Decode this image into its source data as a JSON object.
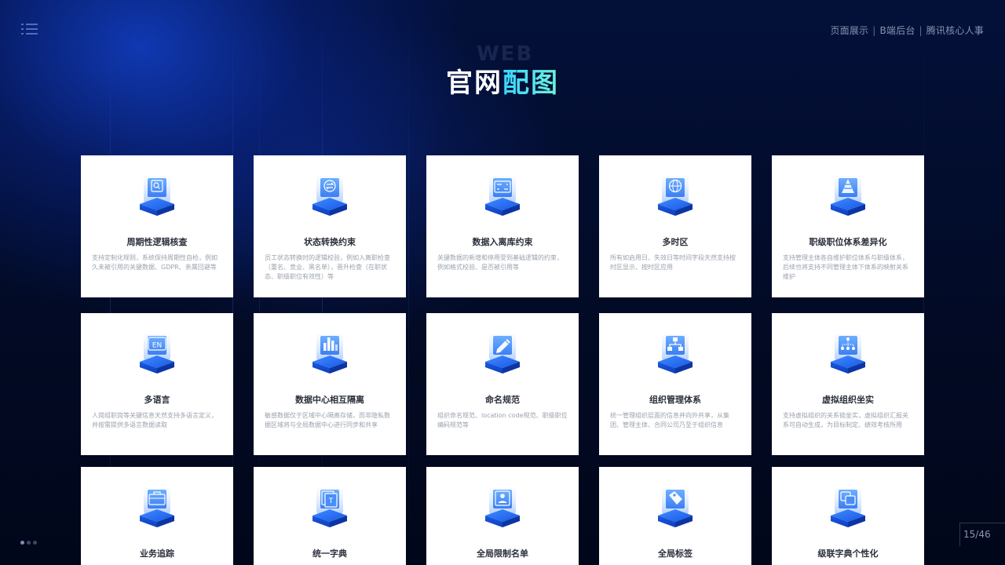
{
  "header": {
    "breadcrumb": [
      "页面展示",
      "B端后台",
      "腾讯核心人事"
    ],
    "title_watermark": "WEB",
    "title_main": "官网",
    "title_accent": "配图"
  },
  "cards": [
    {
      "name": "周期性逻辑核查",
      "desc": "支持定制化规则，系统保持周期性自检，例如久未被引用的关键数据、GDPR、亲属回避等",
      "icon": "search-icon"
    },
    {
      "name": "状态转换约束",
      "desc": "员工状态转换时的逻辑校验，例如入离职检查（重名、竞业、黑名单），晋升检查（在职状态、职级职位有效性）等",
      "icon": "transfer-icon"
    },
    {
      "name": "数据入离库约束",
      "desc": "关键数据的新增和停用受到基础逻辑的约束，例如格式校验、是否被引用等",
      "icon": "database-io-icon"
    },
    {
      "name": "多时区",
      "desc": "所有如启用日、失效日等时间字段天然支持按时区显示、按时区应用",
      "icon": "globe-icon"
    },
    {
      "name": "职级职位体系差异化",
      "desc": "支持管理主体各自维护职位体系与职级体系，后续也将支持不同管理主体下体系的映射关系维护",
      "icon": "pyramid-icon"
    },
    {
      "name": "多语言",
      "desc": "人岗组职岗等关键信息天然支持多语言定义，并按需提供多语言数据读取",
      "icon": "language-en-icon"
    },
    {
      "name": "数据中心相互隔离",
      "desc": "敏感数据仅于区域中心隔离存储，而非隐私数据区域将与全局数据中心进行同步和共享",
      "icon": "bar-chart-icon"
    },
    {
      "name": "命名规范",
      "desc": "组织命名规范、location code规范、职级职位编码规范等",
      "icon": "pencil-icon"
    },
    {
      "name": "组织管理体系",
      "desc": "统一管理组织层面的信息并向外共享，从集团、管理主体、合同公司乃至于组织信息",
      "icon": "org-tree-icon"
    },
    {
      "name": "虚拟组织坐实",
      "desc": "支持虚拟组织的关系链坐实，虚拟组织汇报关系可自动生成，为目标制定、绩效考核所用",
      "icon": "network-icon"
    },
    {
      "name": "业务追踪",
      "desc": "",
      "icon": "briefcase-icon"
    },
    {
      "name": "统一字典",
      "desc": "",
      "icon": "dictionary-icon"
    },
    {
      "name": "全局限制名单",
      "desc": "",
      "icon": "contact-card-icon"
    },
    {
      "name": "全局标签",
      "desc": "",
      "icon": "tag-icon"
    },
    {
      "name": "级联字典个性化",
      "desc": "",
      "icon": "cascade-icon"
    }
  ],
  "footer": {
    "pager": "15/46"
  },
  "colors": {
    "accent_start": "#37d6ff",
    "accent_end": "#6ff2d7",
    "icon_blue": "#2b6cf6",
    "icon_light": "#6fb3ff"
  }
}
